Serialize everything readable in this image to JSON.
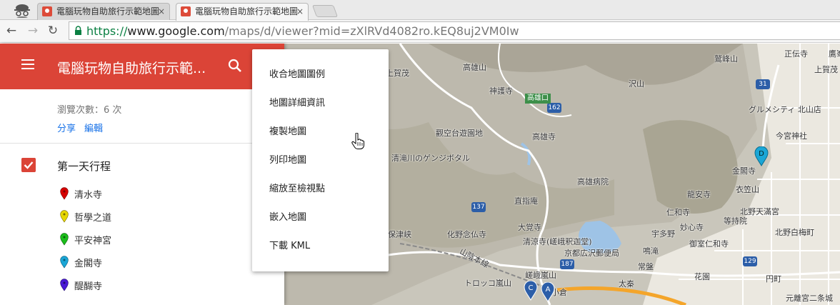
{
  "browser": {
    "tabs": [
      {
        "title": "電腦玩物自助旅行示範地圖",
        "active": false
      },
      {
        "title": "電腦玩物自助旅行示範地圖",
        "active": true
      }
    ],
    "tab_close_glyph": "×",
    "nav_back": "←",
    "nav_forward": "→",
    "nav_reload": "↻",
    "url_scheme": "https://",
    "url_host": "www.google.com",
    "url_path": "/maps/d/viewer?mid=zXlRVd4082ro.kEQ8uj2VM0Iw"
  },
  "panel": {
    "title": "電腦玩物自助旅行示範...",
    "views": "瀏覽次數：6 次",
    "share_label": "分享",
    "edit_label": "編輯",
    "layer_title": "第一天行程",
    "places": [
      {
        "name": "清水寺",
        "color": "#d50000"
      },
      {
        "name": "哲學之道",
        "color": "#e6d700"
      },
      {
        "name": "平安神宮",
        "color": "#1bbd1b"
      },
      {
        "name": "金閣寺",
        "color": "#1aa6d6"
      },
      {
        "name": "醍醐寺",
        "color": "#4a1ad6"
      }
    ]
  },
  "menu": {
    "items": [
      "收合地圖圖例",
      "地圖詳細資訊",
      "複製地圖",
      "列印地圖",
      "縮放至檢視點",
      "嵌入地圖",
      "下載 KML"
    ]
  },
  "map": {
    "labels": [
      {
        "text": "高雄山"
      },
      {
        "text": "神護寺"
      },
      {
        "text": "沢山"
      },
      {
        "text": "鷲峰山"
      },
      {
        "text": "正伝寺"
      },
      {
        "text": "鷹峯"
      },
      {
        "text": "上賀茂"
      },
      {
        "text": "觀空台遊園地"
      },
      {
        "text": "高雄寺"
      },
      {
        "text": "グルメシティ 北山店"
      },
      {
        "text": "今宮神社"
      },
      {
        "text": "高雄病院"
      },
      {
        "text": "金閣寺"
      },
      {
        "text": "龍安寺"
      },
      {
        "text": "衣笠山"
      },
      {
        "text": "直指庵"
      },
      {
        "text": "仁和寺"
      },
      {
        "text": "北野天滿宮"
      },
      {
        "text": "妙心寺"
      },
      {
        "text": "等持院"
      },
      {
        "text": "北野白梅町"
      },
      {
        "text": "大覚寺"
      },
      {
        "text": "清涼寺(嵯峨釈迦堂)"
      },
      {
        "text": "宇多野"
      },
      {
        "text": "御室仁和寺"
      },
      {
        "text": "京都広沢郵便局"
      },
      {
        "text": "鳴滝"
      },
      {
        "text": "化野念仏寺"
      },
      {
        "text": "常盤"
      },
      {
        "text": "花園"
      },
      {
        "text": "円町"
      },
      {
        "text": "嵯峨嵐山"
      },
      {
        "text": "太秦"
      },
      {
        "text": "トロッコ嵐山"
      },
      {
        "text": "保津峡"
      },
      {
        "text": "山陰本線"
      },
      {
        "text": "元離宮二条城"
      },
      {
        "text": "上賀茂"
      },
      {
        "text": "清滝川のゲンジボタル"
      },
      {
        "text": "小倉"
      }
    ],
    "route_signs": [
      "31",
      "162",
      "137",
      "187",
      "129"
    ],
    "green_sign": "高雄口",
    "marker_letters": [
      "D",
      "C",
      "A"
    ]
  }
}
